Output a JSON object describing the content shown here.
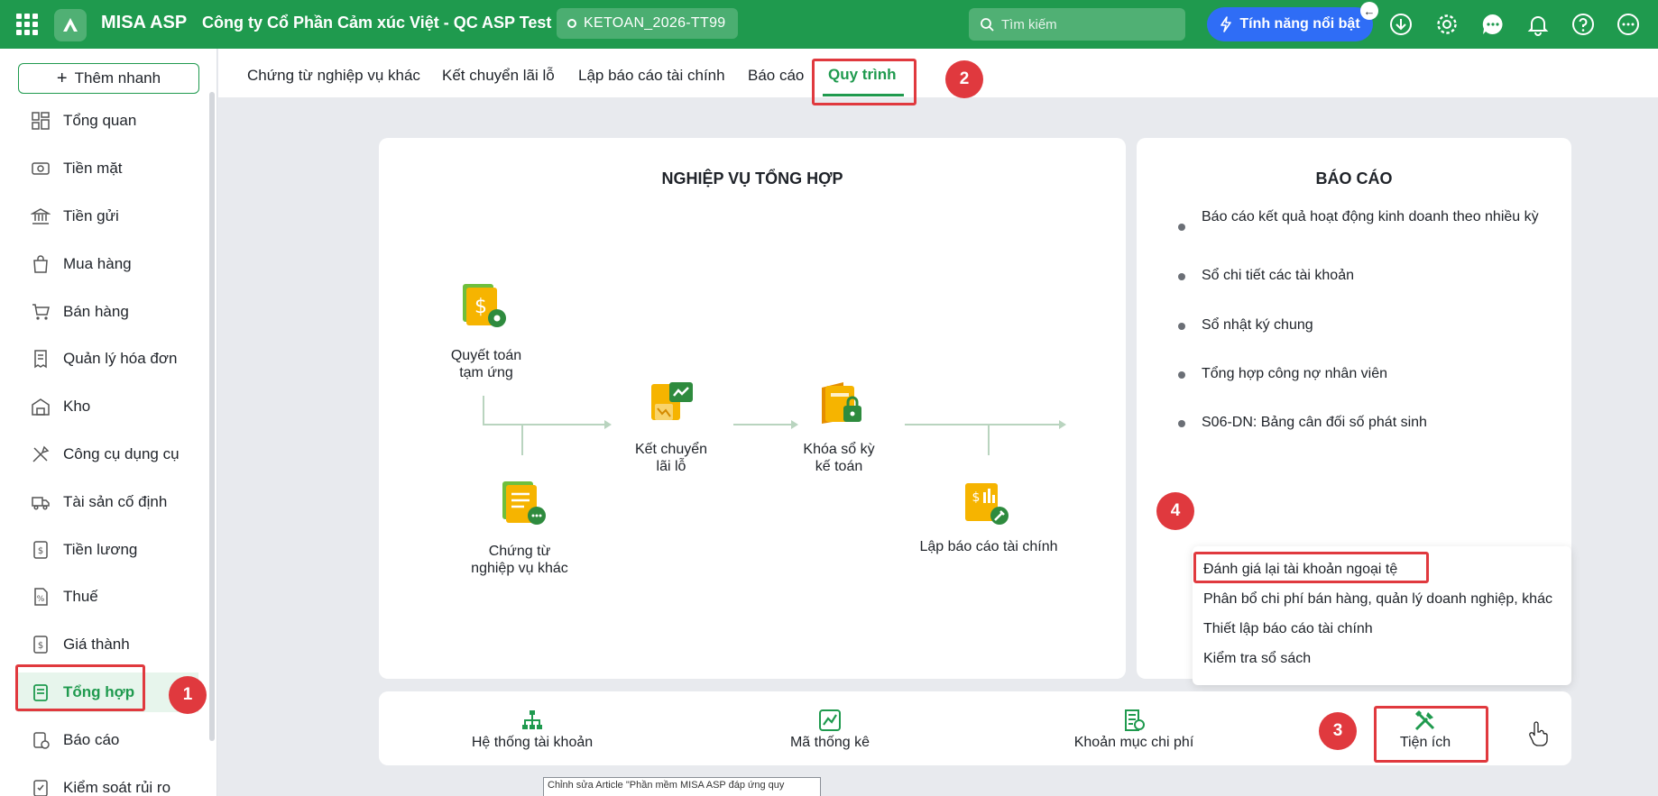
{
  "header": {
    "brand": "MISA ASP",
    "company": "Công ty Cổ Phần Cảm xúc Việt - QC ASP Test",
    "database": "KETOAN_2026-TT99",
    "search_placeholder": "Tìm kiếm",
    "feature_button": "Tính năng nổi bật",
    "icons": [
      "apps-icon",
      "logo-icon",
      "download-icon",
      "gear-icon",
      "chat-icon",
      "bell-icon",
      "help-icon",
      "more-icon"
    ]
  },
  "sidebar": {
    "add_button": "Thêm nhanh",
    "items": [
      {
        "label": "Tổng quan",
        "icon": "dashboard-icon"
      },
      {
        "label": "Tiền mặt",
        "icon": "cash-icon"
      },
      {
        "label": "Tiền gửi",
        "icon": "bank-icon"
      },
      {
        "label": "Mua hàng",
        "icon": "bag-icon"
      },
      {
        "label": "Bán hàng",
        "icon": "cart-icon"
      },
      {
        "label": "Quản lý hóa đơn",
        "icon": "invoice-icon"
      },
      {
        "label": "Kho",
        "icon": "warehouse-icon"
      },
      {
        "label": "Công cụ dụng cụ",
        "icon": "tools-icon"
      },
      {
        "label": "Tài sản cố định",
        "icon": "truck-icon"
      },
      {
        "label": "Tiền lương",
        "icon": "salary-icon"
      },
      {
        "label": "Thuế",
        "icon": "tax-icon"
      },
      {
        "label": "Giá thành",
        "icon": "cost-icon"
      },
      {
        "label": "Tổng hợp",
        "icon": "book-icon",
        "active": true
      },
      {
        "label": "Báo cáo",
        "icon": "report-icon"
      },
      {
        "label": "Kiểm soát rủi ro",
        "icon": "risk-icon"
      }
    ]
  },
  "tabs": [
    {
      "label": "Chứng từ nghiệp vụ khác"
    },
    {
      "label": "Kết chuyển lãi lỗ"
    },
    {
      "label": "Lập báo cáo tài chính"
    },
    {
      "label": "Báo cáo"
    },
    {
      "label": "Quy trình",
      "active": true
    }
  ],
  "steps": [
    "1",
    "2",
    "3",
    "4"
  ],
  "process_panel": {
    "title": "NGHIỆP VỤ TỔNG HỢP",
    "nodes": [
      {
        "line1": "Quyết toán",
        "line2": "tạm ứng"
      },
      {
        "line1": "Chứng từ",
        "line2": "nghiệp vụ khác"
      },
      {
        "line1": "Kết chuyển",
        "line2": "lãi lỗ"
      },
      {
        "line1": "Khóa sổ kỳ",
        "line2": "kế toán"
      },
      {
        "line1": "Lập báo cáo tài chính",
        "line2": ""
      }
    ]
  },
  "report_panel": {
    "title": "BÁO CÁO",
    "items": [
      "Báo cáo kết quả hoạt động kinh doanh theo nhiều kỳ",
      "Sổ chi tiết các tài khoản",
      "Sổ nhật ký chung",
      "Tổng hợp công nợ nhân viên",
      "S06-DN: Bảng cân đối số phát sinh"
    ]
  },
  "utilities_menu": [
    "Đánh giá lại tài khoản ngoại tệ",
    "Phân bổ chi phí bán hàng, quản lý doanh nghiệp, khác",
    "Thiết lập báo cáo tài chính",
    "Kiểm tra sổ sách"
  ],
  "bottom_bar": [
    {
      "label": "Hệ thống tài khoản",
      "icon": "hierarchy-icon"
    },
    {
      "label": "Mã thống kê",
      "icon": "chart-icon"
    },
    {
      "label": "Khoản mục chi phí",
      "icon": "expense-icon"
    },
    {
      "label": "Tiện ích",
      "icon": "tools-icon"
    }
  ],
  "tooltip": "Chỉnh sửa Article \"Phần mềm MISA ASP đáp ứng quy",
  "colors": {
    "brand": "#1f9a4e",
    "accent": "#2f6df6",
    "annotation": "#e0393e"
  }
}
